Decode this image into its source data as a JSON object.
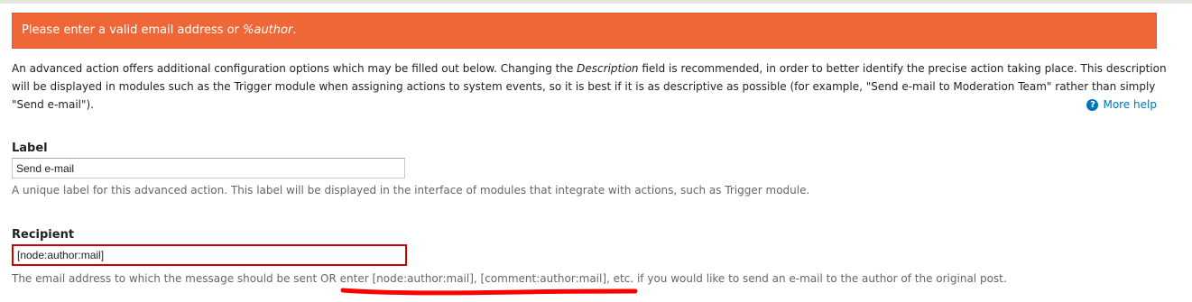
{
  "error": {
    "message": "Please enter a valid email address or ",
    "token": "%author",
    "suffix": "."
  },
  "intro": {
    "part1": "An advanced action offers additional configuration options which may be filled out below. Changing the ",
    "emphasis": "Description",
    "part2": " field is recommended, in order to better identify the precise action taking place. This description will be displayed in modules such as the Trigger module when assigning actions to system events, so it is best if it is as descriptive as possible (for example, \"Send e-mail to Moderation Team\" rather than simply \"Send e-mail\")."
  },
  "help": {
    "icon": "question-circle-icon",
    "label": "More help",
    "color": "#0074bd"
  },
  "label_field": {
    "label": "Label",
    "value": "Send e-mail",
    "description": "A unique label for this advanced action. This label will be displayed in the interface of modules that integrate with actions, such as Trigger module."
  },
  "recipient_field": {
    "label": "Recipient",
    "value": "[node:author:mail]",
    "description": "The email address to which the message should be sent OR enter [node:author:mail], [comment:author:mail], etc. if you would like to send an e-mail to the author of the original post."
  },
  "colors": {
    "error_banner": "#ef6637",
    "error_border": "#d00000",
    "annotation": "#ff0000"
  }
}
